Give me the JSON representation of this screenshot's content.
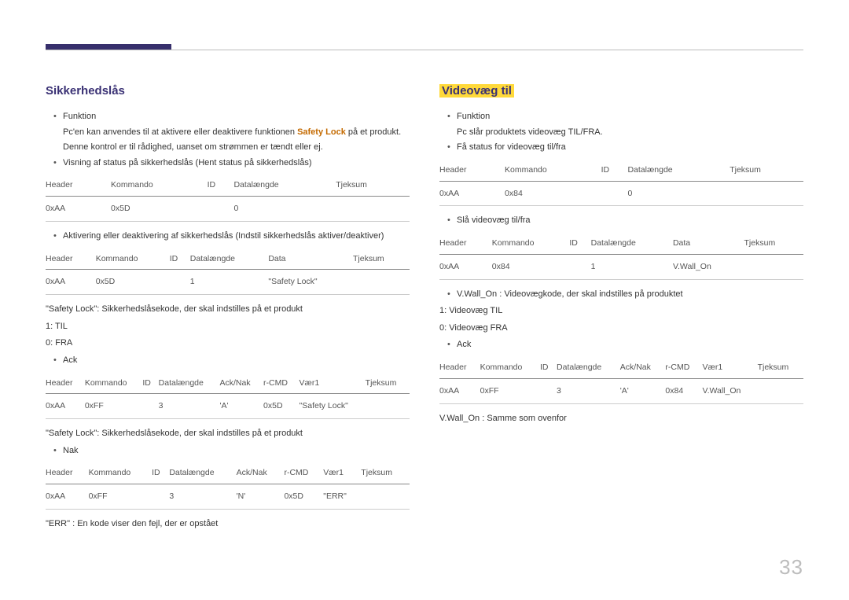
{
  "page_number": "33",
  "left": {
    "title": "Sikkerhedslås",
    "b1": "Funktion",
    "func_line1_a": "Pc'en kan anvendes til at aktivere eller deaktivere funktionen ",
    "func_line1_b": "Safety Lock",
    "func_line1_c": " på et produkt.",
    "func_line2": "Denne kontrol er til rådighed, uanset om strømmen er tændt eller ej.",
    "b2": "Visning af status på sikkerhedslås (Hent status på sikkerhedslås)",
    "t1": {
      "h": [
        "Header",
        "Kommando",
        "ID",
        "Datalængde",
        "Tjeksum"
      ],
      "r": [
        "0xAA",
        "0x5D",
        "",
        "0",
        ""
      ]
    },
    "b3": "Aktivering eller deaktivering af sikkerhedslås (Indstil sikkerhedslås aktiver/deaktiver)",
    "t2": {
      "h": [
        "Header",
        "Kommando",
        "ID",
        "Datalængde",
        "Data",
        "Tjeksum"
      ],
      "r": [
        "0xAA",
        "0x5D",
        "",
        "1",
        "\"Safety Lock\"",
        ""
      ]
    },
    "note1": "\"Safety Lock\": Sikkerhedslåsekode, der skal indstilles på et produkt",
    "note2": "1: TIL",
    "note3": "0: FRA",
    "b4": "Ack",
    "t3": {
      "h": [
        "Header",
        "Kommando",
        "ID",
        "Datalængde",
        "Ack/Nak",
        "r-CMD",
        "Vær1",
        "Tjeksum"
      ],
      "r": [
        "0xAA",
        "0xFF",
        "",
        "3",
        "'A'",
        "0x5D",
        "\"Safety Lock\"",
        ""
      ]
    },
    "note4": "\"Safety Lock\": Sikkerhedslåsekode, der skal indstilles på et produkt",
    "b5": "Nak",
    "t4": {
      "h": [
        "Header",
        "Kommando",
        "ID",
        "Datalængde",
        "Ack/Nak",
        "r-CMD",
        "Vær1",
        "Tjeksum"
      ],
      "r": [
        "0xAA",
        "0xFF",
        "",
        "3",
        "'N'",
        "0x5D",
        "\"ERR\"",
        ""
      ]
    },
    "note5": "\"ERR\" : En kode viser den fejl, der er opstået"
  },
  "right": {
    "title": "Videovæg til",
    "b1": "Funktion",
    "func_line1": "Pc slår produktets videovæg TIL/FRA.",
    "b2": "Få status for videovæg til/fra",
    "t1": {
      "h": [
        "Header",
        "Kommando",
        "ID",
        "Datalængde",
        "Tjeksum"
      ],
      "r": [
        "0xAA",
        "0x84",
        "",
        "0",
        ""
      ]
    },
    "b3": "Slå videovæg til/fra",
    "t2": {
      "h": [
        "Header",
        "Kommando",
        "ID",
        "Datalængde",
        "Data",
        "Tjeksum"
      ],
      "r": [
        "0xAA",
        "0x84",
        "",
        "1",
        "V.Wall_On",
        ""
      ]
    },
    "b4": "V.Wall_On : Videovægkode, der skal indstilles på produktet",
    "note1": "1: Videovæg TIL",
    "note2": "0: Videovæg FRA",
    "b5": "Ack",
    "t3": {
      "h": [
        "Header",
        "Kommando",
        "ID",
        "Datalængde",
        "Ack/Nak",
        "r-CMD",
        "Vær1",
        "Tjeksum"
      ],
      "r": [
        "0xAA",
        "0xFF",
        "",
        "3",
        "'A'",
        "0x84",
        "V.Wall_On",
        ""
      ]
    },
    "note3": "V.Wall_On : Samme som ovenfor"
  }
}
